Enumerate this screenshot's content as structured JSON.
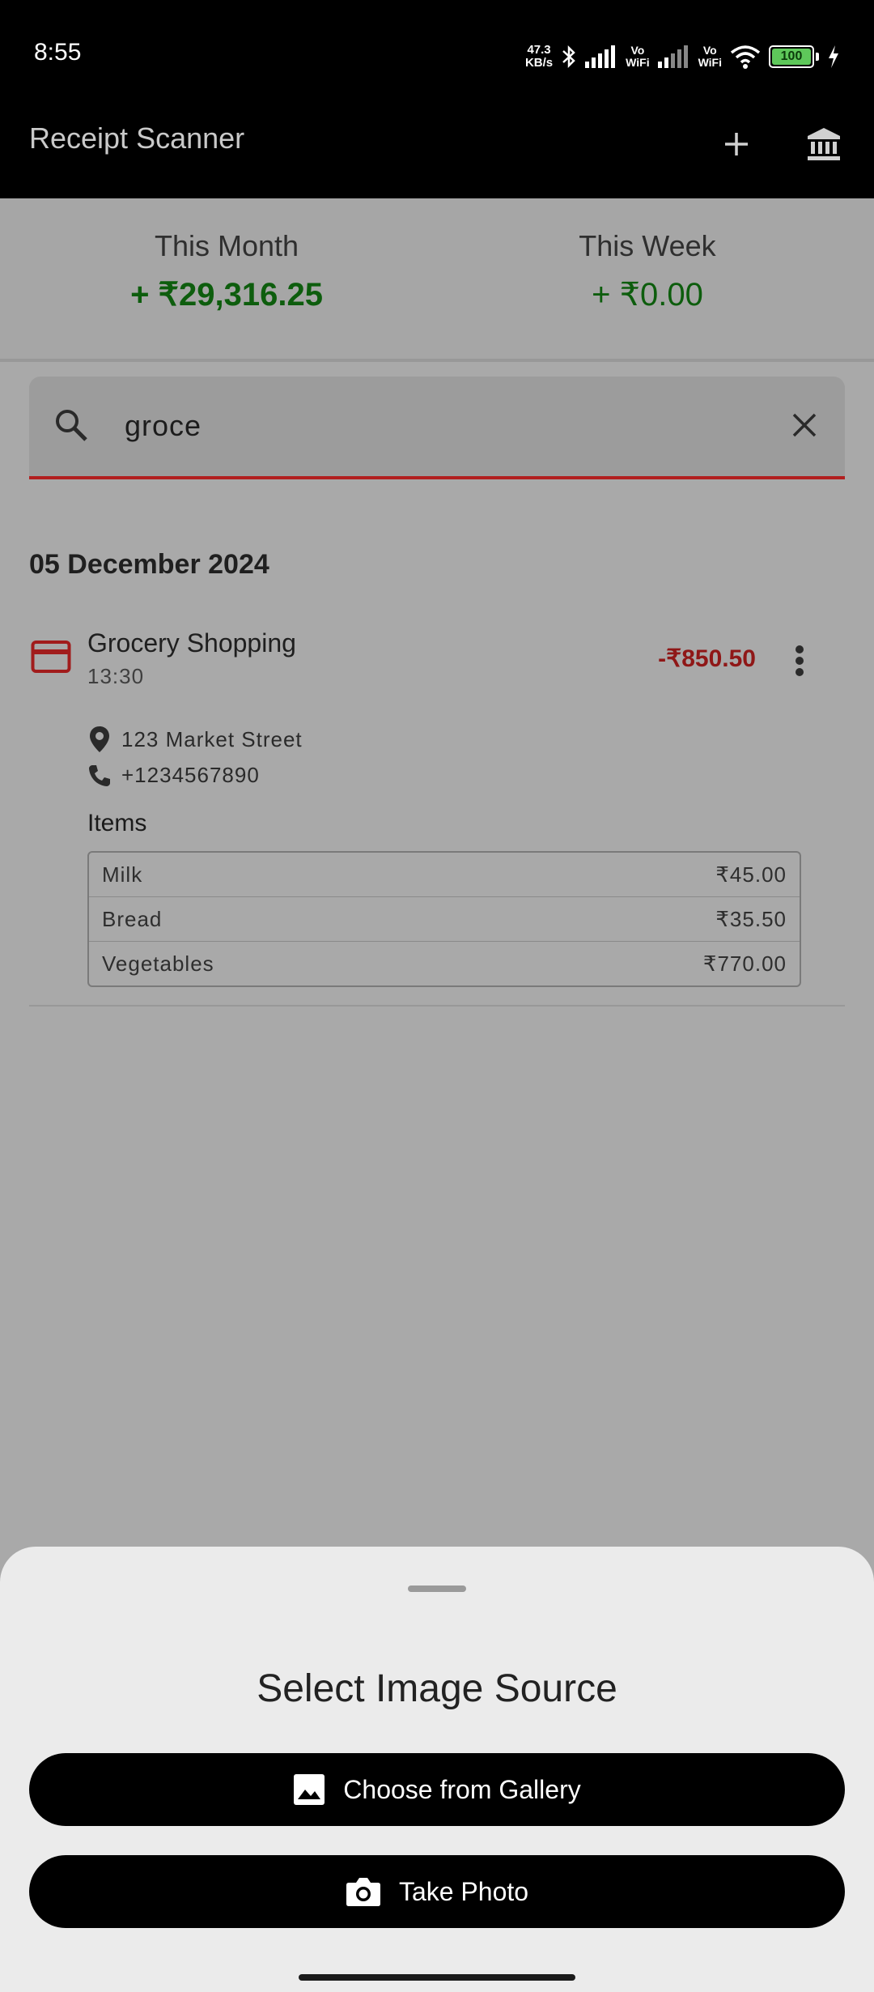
{
  "status_bar": {
    "time": "8:55",
    "net_speed_value": "47.3",
    "net_speed_unit": "KB/s",
    "vowifi_1": "Vo\nWiFi",
    "vowifi_2": "Vo\nWiFi",
    "battery": "100"
  },
  "app_bar": {
    "title": "Receipt Scanner",
    "add_icon": "plus-icon",
    "bank_icon": "bank-icon"
  },
  "summary": {
    "month_label": "This Month",
    "month_value": "+ ₹29,316.25",
    "week_label": "This Week",
    "week_value": "+ ₹0.00",
    "positive_color": "#0d5d0d"
  },
  "search": {
    "query": "groce",
    "accent_color": "#b21f1f"
  },
  "list": {
    "date_header": "05 December 2024",
    "transaction": {
      "title": "Grocery Shopping",
      "time": "13:30",
      "amount": "-₹850.50",
      "amount_color": "#8f1717",
      "address": "123 Market Street",
      "phone": "+1234567890",
      "items_label": "Items",
      "items": [
        {
          "name": "Milk",
          "price": "₹45.00"
        },
        {
          "name": "Bread",
          "price": "₹35.50"
        },
        {
          "name": "Vegetables",
          "price": "₹770.00"
        }
      ]
    }
  },
  "sheet": {
    "title": "Select Image Source",
    "gallery_label": "Choose from Gallery",
    "camera_label": "Take Photo"
  }
}
